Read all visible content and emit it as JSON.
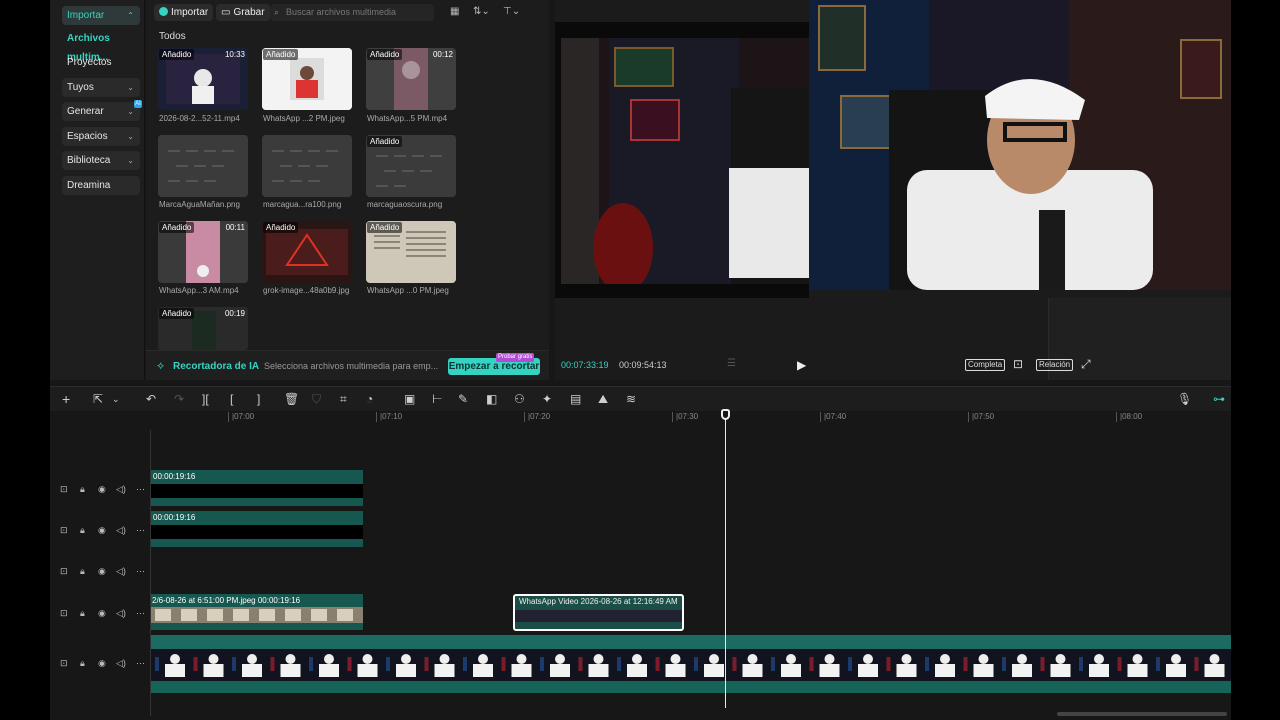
{
  "sidebar": {
    "items": [
      {
        "label": "Importar",
        "arrow": "⌃"
      },
      {
        "label": "Archivos multim..."
      },
      {
        "label": "Proyectos secun..."
      },
      {
        "label": "Tuyos",
        "arrow": "⌄"
      },
      {
        "label": "Generar",
        "arrow": "⌄"
      },
      {
        "label": "Espacios",
        "arrow": "⌄"
      },
      {
        "label": "Biblioteca",
        "arrow": "⌄"
      },
      {
        "label": "Dreamina"
      }
    ],
    "ai_badge": "AI"
  },
  "media": {
    "import_label": "Importar",
    "record_label": "Grabar",
    "search_placeholder": "Buscar archivos multimedia",
    "section_title": "Todos",
    "items": [
      {
        "name": "2026-08-2...52-11.mp4",
        "badge": "Añadido",
        "duration": "10:33"
      },
      {
        "name": "WhatsApp ...2 PM.jpeg",
        "badge": "Añadido",
        "duration": ""
      },
      {
        "name": "WhatsApp...5 PM.mp4",
        "badge": "Añadido",
        "duration": "00:12"
      },
      {
        "name": "MarcaAguaMañan.png",
        "badge": "",
        "duration": ""
      },
      {
        "name": "marcagua...ra100.png",
        "badge": "",
        "duration": ""
      },
      {
        "name": "marcaguaoscura.png",
        "badge": "Añadido",
        "duration": ""
      },
      {
        "name": "WhatsApp...3 AM.mp4",
        "badge": "Añadido",
        "duration": "00:11"
      },
      {
        "name": "grok-image...48a0b9.jpg",
        "badge": "Añadido",
        "duration": ""
      },
      {
        "name": "WhatsApp ...0 PM.jpeg",
        "badge": "Añadido",
        "duration": ""
      },
      {
        "name": "",
        "badge": "Añadido",
        "duration": "00:19"
      }
    ],
    "cropper": {
      "title": "Recortadora de IA",
      "description": "Selecciona archivos multimedia para emp...",
      "button": "Empezar a recortar",
      "badge": "Probar gratis"
    }
  },
  "preview": {
    "current_time": "00:07:33:19",
    "total_time": "00:09:54:13",
    "full_label": "Completa",
    "ratio_label": "Relación"
  },
  "timeline": {
    "ruler": [
      "|07:00",
      "|07:10",
      "|07:20",
      "|07:30",
      "|07:40",
      "|07:50",
      "|08:00"
    ],
    "tracks": [
      {
        "clip_label": "00:00:19:16"
      },
      {
        "clip_label": "00:00:19:16"
      },
      {
        "clip_label": ""
      },
      {
        "clip_label": "2/6-08-26 at 6:51:00 PM.jpeg   00:00:19:16",
        "second_clip": "WhatsApp Video 2026-08-26 at 12:16:49 AM"
      },
      {
        "clip_label": ""
      }
    ]
  },
  "colors": {
    "accent": "#35d3c2",
    "clip_teal": "#16574f"
  }
}
